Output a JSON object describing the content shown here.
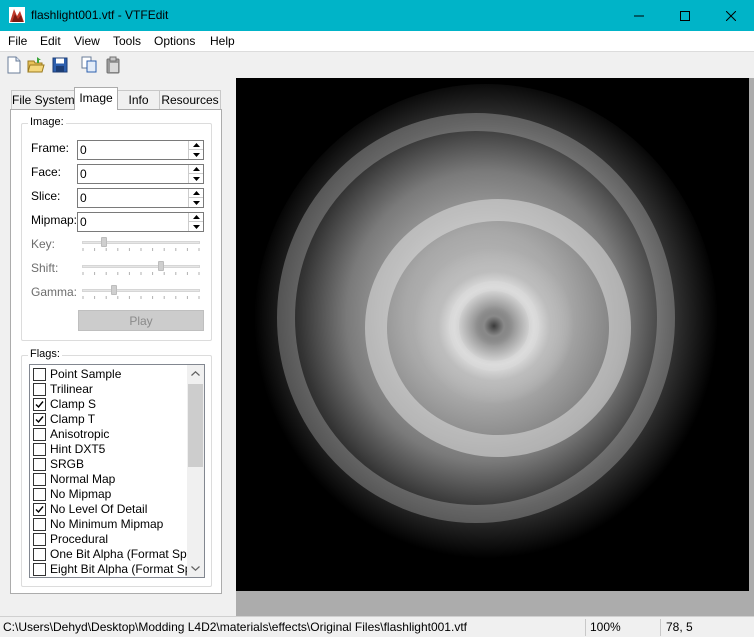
{
  "window": {
    "title": "flashlight001.vtf - VTFEdit"
  },
  "menu": [
    "File",
    "Edit",
    "View",
    "Tools",
    "Options",
    "Help"
  ],
  "toolbar": {
    "icons": [
      "new-file-icon",
      "open-folder-icon",
      "save-icon",
      "copy-icon",
      "paste-icon"
    ]
  },
  "tabs": [
    "File System",
    "Image",
    "Info",
    "Resources"
  ],
  "active_tab": "Image",
  "image_group": {
    "label": "Image:",
    "frame": {
      "label": "Frame:",
      "value": "0"
    },
    "face": {
      "label": "Face:",
      "value": "0"
    },
    "slice": {
      "label": "Slice:",
      "value": "0"
    },
    "mipmap": {
      "label": "Mipmap:",
      "value": "0"
    },
    "key": {
      "label": "Key:",
      "level": 0.17
    },
    "shift": {
      "label": "Shift:",
      "level": 0.68
    },
    "gamma": {
      "label": "Gamma:",
      "level": 0.26
    },
    "play_label": "Play"
  },
  "flags_group": {
    "label": "Flags:",
    "items": [
      {
        "label": "Point Sample",
        "checked": false
      },
      {
        "label": "Trilinear",
        "checked": false
      },
      {
        "label": "Clamp S",
        "checked": true
      },
      {
        "label": "Clamp T",
        "checked": true
      },
      {
        "label": "Anisotropic",
        "checked": false
      },
      {
        "label": "Hint DXT5",
        "checked": false
      },
      {
        "label": "SRGB",
        "checked": false
      },
      {
        "label": "Normal Map",
        "checked": false
      },
      {
        "label": "No Mipmap",
        "checked": false
      },
      {
        "label": "No Level Of Detail",
        "checked": true
      },
      {
        "label": "No Minimum Mipmap",
        "checked": false
      },
      {
        "label": "Procedural",
        "checked": false
      },
      {
        "label": "One Bit Alpha (Format Spec",
        "checked": false
      },
      {
        "label": "Eight Bit Alpha (Format Spe",
        "checked": false
      }
    ]
  },
  "status": {
    "path": "C:\\Users\\Dehyd\\Desktop\\Modding L4D2\\materials\\effects\\Original Files\\flashlight001.vtf",
    "zoom": "100%",
    "coords": "78, 5"
  },
  "colors": {
    "titlebar": "#00b4c8",
    "preview_background": "#000000",
    "canvas_background": "#acacac"
  }
}
